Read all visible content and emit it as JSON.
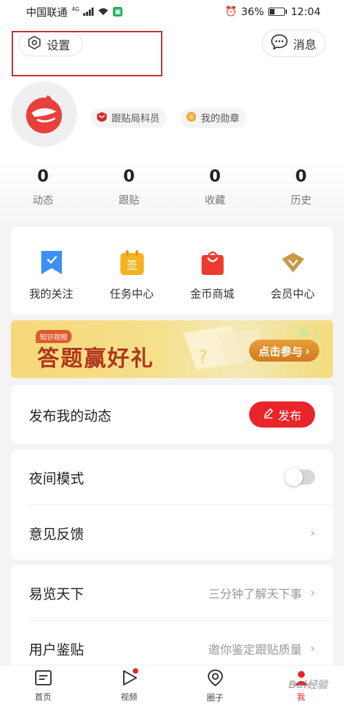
{
  "status_bar": {
    "carrier": "中国联通",
    "network": "4G",
    "battery": "36%",
    "time": "12:04",
    "battery_level": 0.36
  },
  "header": {
    "settings_label": "设置",
    "messages_label": "消息",
    "username": "",
    "badges": [
      "跟贴局科员",
      "我的勋章"
    ]
  },
  "stats": [
    {
      "value": "0",
      "label": "动态"
    },
    {
      "value": "0",
      "label": "跟贴"
    },
    {
      "value": "0",
      "label": "收藏"
    },
    {
      "value": "0",
      "label": "历史"
    }
  ],
  "shortcuts": [
    {
      "label": "我的关注",
      "icon": "bookmark-icon",
      "color": "#3d8ef5"
    },
    {
      "label": "任务中心",
      "icon": "sign-in-icon",
      "color": "#f5b21f"
    },
    {
      "label": "金币商城",
      "icon": "shopping-bag-icon",
      "color": "#ef3b2d"
    },
    {
      "label": "会员中心",
      "icon": "member-diamond-icon",
      "color": "#c99a4a"
    }
  ],
  "banner": {
    "tag": "知识视频",
    "title": "答题赢好礼",
    "cta": "点击参与"
  },
  "publish": {
    "title": "发布我的动态",
    "button": "发布"
  },
  "settings_list": [
    {
      "title": "夜间模式",
      "type": "toggle",
      "on": false
    },
    {
      "title": "意见反馈",
      "type": "link"
    }
  ],
  "info_list": [
    {
      "title": "易览天下",
      "hint": "三分钟了解天下事"
    },
    {
      "title": "用户鉴贴",
      "hint": "邀你鉴定跟贴质量"
    }
  ],
  "tabbar": [
    {
      "label": "首页",
      "icon": "home-icon",
      "active": false
    },
    {
      "label": "视频",
      "icon": "play-icon",
      "active": false,
      "dot": true
    },
    {
      "label": "圈子",
      "icon": "location-circle-icon",
      "active": false
    },
    {
      "label": "我",
      "icon": "profile-icon",
      "active": true
    }
  ],
  "colors": {
    "accent_red": "#e8252b",
    "highlight_box": "#c8282c"
  }
}
